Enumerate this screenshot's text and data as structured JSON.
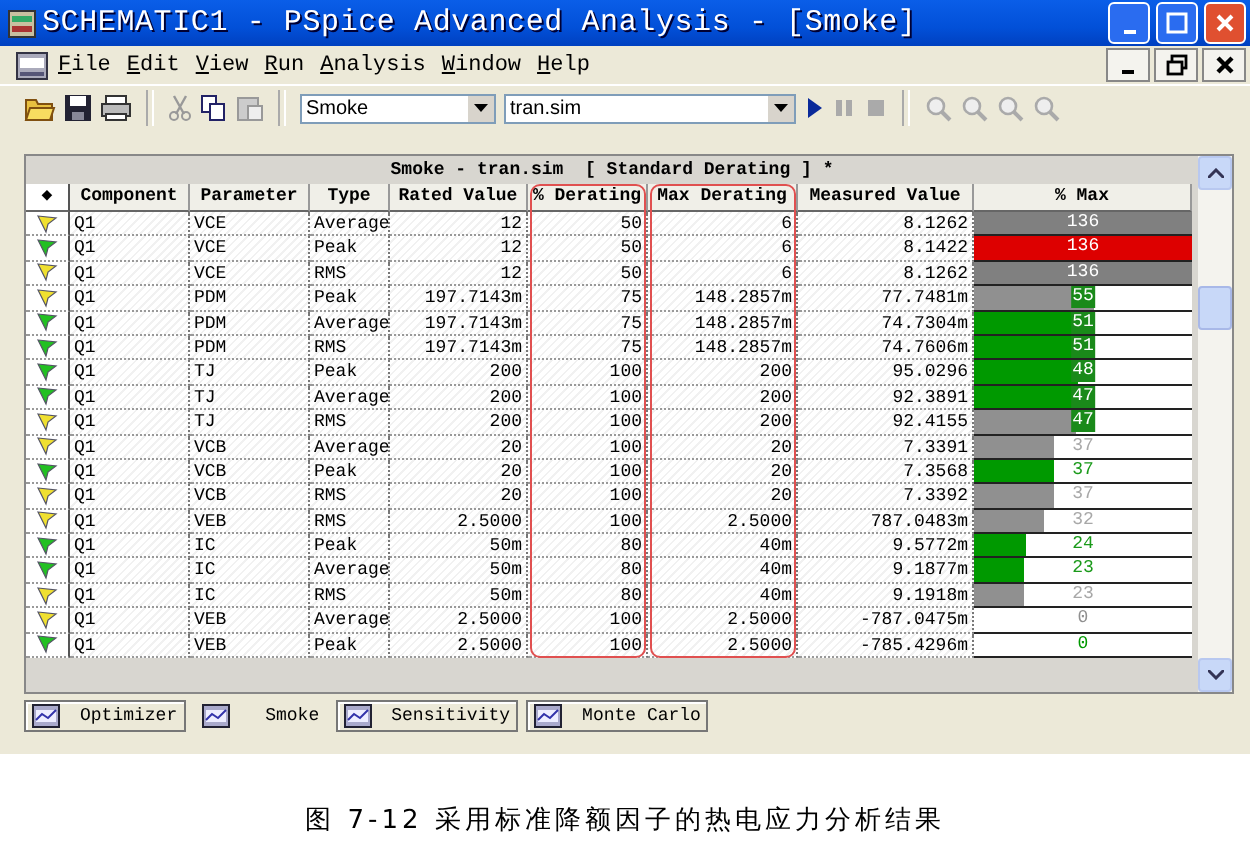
{
  "window": {
    "title": "SCHEMATIC1 - PSpice Advanced Analysis - [Smoke]"
  },
  "menu": [
    "File",
    "Edit",
    "View",
    "Run",
    "Analysis",
    "Window",
    "Help"
  ],
  "toolbar": {
    "profile": "Smoke",
    "simulation": "tran.sim"
  },
  "table": {
    "title": "Smoke - tran.sim  [ Standard Derating ] *",
    "columns": [
      {
        "label": "◆",
        "highlighted": false
      },
      {
        "label": "Component",
        "highlighted": false
      },
      {
        "label": "Parameter",
        "highlighted": false
      },
      {
        "label": "Type",
        "highlighted": false
      },
      {
        "label": "Rated Value",
        "highlighted": false
      },
      {
        "label": "% Derating",
        "highlighted": true
      },
      {
        "label": "Max Derating",
        "highlighted": true
      },
      {
        "label": "Measured Value",
        "highlighted": false
      },
      {
        "label": "% Max",
        "highlighted": false
      }
    ],
    "rows": [
      {
        "warning": true,
        "component": "Q1",
        "parameter": "VCE",
        "type": "Average",
        "rated_value": "12",
        "derating": "50",
        "max_derating": "6",
        "measured_value": "8.1262",
        "max_percent": "136",
        "level": 1,
        "color": "#808080"
      },
      {
        "warning": false,
        "component": "Q1",
        "parameter": "VCE",
        "type": "Peak",
        "rated_value": "12",
        "derating": "50",
        "max_derating": "6",
        "measured_value": "8.1422",
        "max_percent": "136",
        "level": 1,
        "color": "#dd0000"
      },
      {
        "warning": true,
        "component": "Q1",
        "parameter": "VCE",
        "type": "RMS",
        "rated_value": "12",
        "derating": "50",
        "max_derating": "6",
        "measured_value": "8.1262",
        "max_percent": "136",
        "level": 1,
        "color": "#808080"
      },
      {
        "warning": true,
        "component": "Q1",
        "parameter": "PDM",
        "type": "Peak",
        "rated_value": "197.7143m",
        "derating": "75",
        "max_derating": "148.2857m",
        "measured_value": "77.7481m",
        "max_percent": "55",
        "level": 0.55,
        "color": "#909090"
      },
      {
        "warning": false,
        "component": "Q1",
        "parameter": "PDM",
        "type": "Average",
        "rated_value": "197.7143m",
        "derating": "75",
        "max_derating": "148.2857m",
        "measured_value": "74.7304m",
        "max_percent": "51",
        "level": 0.51,
        "color": "#009900"
      },
      {
        "warning": false,
        "component": "Q1",
        "parameter": "PDM",
        "type": "RMS",
        "rated_value": "197.7143m",
        "derating": "75",
        "max_derating": "148.2857m",
        "measured_value": "74.7606m",
        "max_percent": "51",
        "level": 0.51,
        "color": "#009900"
      },
      {
        "warning": false,
        "component": "Q1",
        "parameter": "TJ",
        "type": "Peak",
        "rated_value": "200",
        "derating": "100",
        "max_derating": "200",
        "measured_value": "95.0296",
        "max_percent": "48",
        "level": 0.48,
        "color": "#009900"
      },
      {
        "warning": false,
        "component": "Q1",
        "parameter": "TJ",
        "type": "Average",
        "rated_value": "200",
        "derating": "100",
        "max_derating": "200",
        "measured_value": "92.3891",
        "max_percent": "47",
        "level": 0.47,
        "color": "#009900"
      },
      {
        "warning": true,
        "component": "Q1",
        "parameter": "TJ",
        "type": "RMS",
        "rated_value": "200",
        "derating": "100",
        "max_derating": "200",
        "measured_value": "92.4155",
        "max_percent": "47",
        "level": 0.47,
        "color": "#909090"
      },
      {
        "warning": true,
        "component": "Q1",
        "parameter": "VCB",
        "type": "Average",
        "rated_value": "20",
        "derating": "100",
        "max_derating": "20",
        "measured_value": "7.3391",
        "max_percent": "37",
        "level": 0.37,
        "color": "#909090"
      },
      {
        "warning": false,
        "component": "Q1",
        "parameter": "VCB",
        "type": "Peak",
        "rated_value": "20",
        "derating": "100",
        "max_derating": "20",
        "measured_value": "7.3568",
        "max_percent": "37",
        "level": 0.37,
        "color": "#009900"
      },
      {
        "warning": true,
        "component": "Q1",
        "parameter": "VCB",
        "type": "RMS",
        "rated_value": "20",
        "derating": "100",
        "max_derating": "20",
        "measured_value": "7.3392",
        "max_percent": "37",
        "level": 0.37,
        "color": "#909090"
      },
      {
        "warning": true,
        "component": "Q1",
        "parameter": "VEB",
        "type": "RMS",
        "rated_value": "2.5000",
        "derating": "100",
        "max_derating": "2.5000",
        "measured_value": "787.0483m",
        "max_percent": "32",
        "level": 0.32,
        "color": "#909090"
      },
      {
        "warning": false,
        "component": "Q1",
        "parameter": "IC",
        "type": "Peak",
        "rated_value": "50m",
        "derating": "80",
        "max_derating": "40m",
        "measured_value": "9.5772m",
        "max_percent": "24",
        "level": 0.24,
        "color": "#009900"
      },
      {
        "warning": false,
        "component": "Q1",
        "parameter": "IC",
        "type": "Average",
        "rated_value": "50m",
        "derating": "80",
        "max_derating": "40m",
        "measured_value": "9.1877m",
        "max_percent": "23",
        "level": 0.23,
        "color": "#009900"
      },
      {
        "warning": true,
        "component": "Q1",
        "parameter": "IC",
        "type": "RMS",
        "rated_value": "50m",
        "derating": "80",
        "max_derating": "40m",
        "measured_value": "9.1918m",
        "max_percent": "23",
        "level": 0.23,
        "color": "#909090"
      },
      {
        "warning": true,
        "component": "Q1",
        "parameter": "VEB",
        "type": "Average",
        "rated_value": "2.5000",
        "derating": "100",
        "max_derating": "2.5000",
        "measured_value": "-787.0475m",
        "max_percent": "0",
        "level": 0,
        "color": "#909090"
      },
      {
        "warning": false,
        "component": "Q1",
        "parameter": "VEB",
        "type": "Peak",
        "rated_value": "2.5000",
        "derating": "100",
        "max_derating": "2.5000",
        "measured_value": "-785.4296m",
        "max_percent": "0",
        "level": 0,
        "color": "#009900"
      }
    ]
  },
  "tabs": [
    {
      "label": "Optimizer",
      "selected": false
    },
    {
      "label": "Smoke",
      "selected": true
    },
    {
      "label": "Sensitivity",
      "selected": false
    },
    {
      "label": "Monte Carlo",
      "selected": false
    }
  ],
  "caption": "图 7-12 采用标准降额因子的热电应力分析结果"
}
